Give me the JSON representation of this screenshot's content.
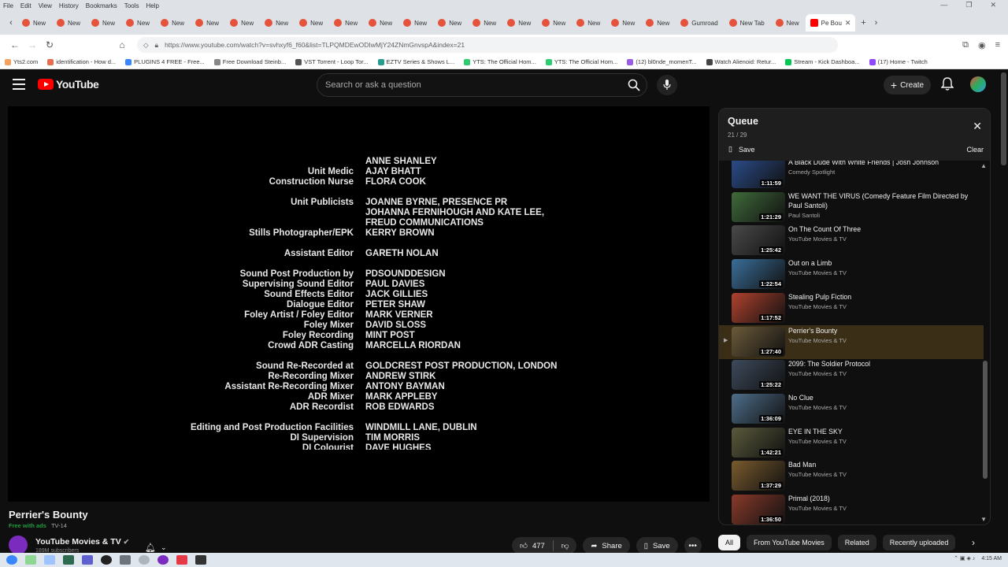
{
  "menubar": [
    "File",
    "Edit",
    "View",
    "History",
    "Bookmarks",
    "Tools",
    "Help"
  ],
  "tabs": {
    "labels": [
      "New",
      "New",
      "New",
      "New",
      "New",
      "New",
      "New",
      "New",
      "New",
      "New",
      "New",
      "New",
      "New",
      "New",
      "New",
      "New",
      "New",
      "New",
      "New",
      "Gumroad",
      "New Tab",
      "New"
    ],
    "active": "Pe Bou"
  },
  "address": {
    "url": "https://www.youtube.com/watch?v=svhxyf6_f60&list=TLPQMDEwODIwMjY24ZNmGnvspA&index=21"
  },
  "bookmarks": [
    "Yts2.com",
    "identification - How d...",
    "PLUGINS 4 FREE - Free...",
    "Free Download Steinb...",
    "VST Torrent - Loop Tor...",
    "EZTV Series & Shows L...",
    "YTS: The Official Hom...",
    "YTS: The Official Hom...",
    "(12) bl0nde_momenT...",
    "Watch Alienoid: Retur...",
    "Stream - Kick Dashboa...",
    "(17) Home - Twitch"
  ],
  "header": {
    "logo": "YouTube",
    "search_placeholder": "Search or ask a question",
    "create": "Create"
  },
  "credits": [
    {
      "role": "",
      "name": "ANNE SHANLEY"
    },
    {
      "role": "Unit Medic",
      "name": "AJAY BHATT"
    },
    {
      "role": "Construction Nurse",
      "name": "FLORA COOK"
    },
    {
      "role": "Unit Publicists",
      "name": "JOANNE BYRNE, PRESENCE PR"
    },
    {
      "role": "",
      "name": "JOHANNA FERNIHOUGH AND KATE LEE,"
    },
    {
      "role": "",
      "name": "FREUD COMMUNICATIONS"
    },
    {
      "role": "Stills Photographer/EPK",
      "name": "KERRY BROWN"
    },
    {
      "role": "Assistant Editor",
      "name": "GARETH NOLAN"
    },
    {
      "role": "Sound Post Production by",
      "name": "PDSOUNDDESIGN"
    },
    {
      "role": "Supervising Sound Editor",
      "name": "PAUL DAVIES"
    },
    {
      "role": "Sound Effects Editor",
      "name": "JACK GILLIES"
    },
    {
      "role": "Dialogue Editor",
      "name": "PETER SHAW"
    },
    {
      "role": "Foley Artist / Foley Editor",
      "name": "MARK VERNER"
    },
    {
      "role": "Foley Mixer",
      "name": "DAVID SLOSS"
    },
    {
      "role": "Foley Recording",
      "name": "MINT POST"
    },
    {
      "role": "Crowd ADR Casting",
      "name": "MARCELLA RIORDAN"
    },
    {
      "role": "Sound Re-Recorded at",
      "name": "GOLDCREST POST PRODUCTION, LONDON"
    },
    {
      "role": "Re-Recording Mixer",
      "name": "ANDREW STIRK"
    },
    {
      "role": "Assistant Re-Recording Mixer",
      "name": "ANTONY BAYMAN"
    },
    {
      "role": "ADR Mixer",
      "name": "MARK APPLEBY"
    },
    {
      "role": "ADR Recordist",
      "name": "ROB EDWARDS"
    },
    {
      "role": "Editing and Post Production Facilities",
      "name": "WINDMILL LANE, DUBLIN"
    },
    {
      "role": "DI Supervision",
      "name": "TIM MORRIS"
    },
    {
      "role": "DI Colourist",
      "name": "DAVE HUGHES"
    }
  ],
  "video": {
    "title": "Perrier's Bounty",
    "free": "Free with ads",
    "rating": "TV-14",
    "channel": "YouTube Movies & TV",
    "channel_sub": "189M subscribers",
    "likes": "477",
    "share": "Share",
    "save": "Save"
  },
  "queue": {
    "title": "Queue",
    "count": "21 / 29",
    "save": "Save",
    "clear": "Clear",
    "items": [
      {
        "title": "A Black Dude With White Friends | Josh Johnson",
        "channel": "Comedy Spotlight",
        "duration": "1:11:59",
        "color": "#2b4d8c"
      },
      {
        "title": "WE WANT THE VIRUS (Comedy Feature Film Directed by Paul Santoli)",
        "channel": "Paul Santoli",
        "duration": "1:21:29",
        "color": "#3f6b3a"
      },
      {
        "title": "On The Count Of Three",
        "channel": "YouTube Movies & TV",
        "duration": "1:25:42",
        "color": "#4a4a4a"
      },
      {
        "title": "Out on a Limb",
        "channel": "YouTube Movies & TV",
        "duration": "1:22:54",
        "color": "#3a6f9a"
      },
      {
        "title": "Stealing Pulp Fiction",
        "channel": "YouTube Movies & TV",
        "duration": "1:17:52",
        "color": "#b0422e"
      },
      {
        "title": "Perrier's Bounty",
        "channel": "YouTube Movies & TV",
        "duration": "1:27:40",
        "color": "#6b5a3a"
      },
      {
        "title": "2099: The Soldier Protocol",
        "channel": "YouTube Movies & TV",
        "duration": "1:25:22",
        "color": "#3d4a5c"
      },
      {
        "title": "No Clue",
        "channel": "YouTube Movies & TV",
        "duration": "1:36:09",
        "color": "#4e6e8a"
      },
      {
        "title": "EYE IN THE SKY",
        "channel": "YouTube Movies & TV",
        "duration": "1:42:21",
        "color": "#5a5a3c"
      },
      {
        "title": "Bad Man",
        "channel": "YouTube Movies & TV",
        "duration": "1:37:29",
        "color": "#7a5b2e"
      },
      {
        "title": "Primal (2018)",
        "channel": "YouTube Movies & TV",
        "duration": "1:36:50",
        "color": "#8a3a2a"
      }
    ]
  },
  "chips": [
    "All",
    "From YouTube Movies",
    "Related",
    "Recently uploaded"
  ],
  "taskbar": {
    "time": "4:15 AM"
  },
  "colors": {
    "accent": "#ff0000",
    "current_row": "#3a2e16",
    "bg": "#0f0f0f"
  }
}
